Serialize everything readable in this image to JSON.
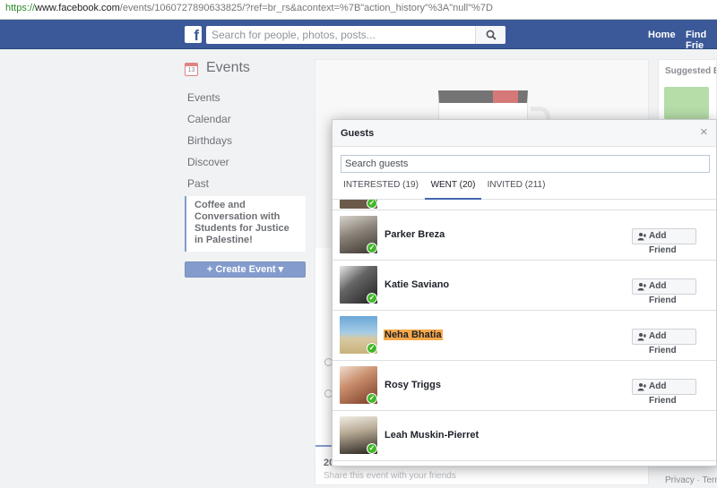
{
  "browser": {
    "url_scheme": "https://",
    "url_host": "www.facebook.com",
    "url_path": "/events/1060727890633825/?ref=br_rs&acontext=%7B\"action_history\"%3A\"null\"%7D"
  },
  "topbar": {
    "logo": "f",
    "search_placeholder": "Search for people, photos, posts...",
    "nav": [
      "Home",
      "Find Frie"
    ]
  },
  "left": {
    "calendar_icon_day": "13",
    "title": "Events",
    "items": [
      "Events",
      "Calendar",
      "Birthdays",
      "Discover",
      "Past"
    ],
    "selected_event": "Coffee and Conversation with Students for Justice in Palestine!",
    "create_button": "+ Create Event ▾"
  },
  "event_panel": {
    "count_text": "20",
    "share_text": "Share this event with your friends"
  },
  "right": {
    "title": "Suggested Ev",
    "footer": "Privacy · Term"
  },
  "dialog": {
    "title": "Guests",
    "close": "×",
    "search_placeholder": "Search guests",
    "tabs": [
      {
        "label": "INTERESTED (19)",
        "active": false
      },
      {
        "label": "WENT (20)",
        "active": true
      },
      {
        "label": "INVITED (211)",
        "active": false
      }
    ],
    "add_friend_label": "Add Friend",
    "guests": [
      {
        "name": "Parker Breza",
        "highlighted": false,
        "add_friend": true
      },
      {
        "name": "Katie Saviano",
        "highlighted": false,
        "add_friend": true
      },
      {
        "name": "Neha Bhatia",
        "highlighted": true,
        "add_friend": true
      },
      {
        "name": "Rosy Triggs",
        "highlighted": false,
        "add_friend": true
      },
      {
        "name": "Leah Muskin-Pierret",
        "highlighted": false,
        "add_friend": false
      }
    ],
    "colors": {
      "accent": "#4267b2",
      "went_check": "#42b72a",
      "highlight": "#f7a94a"
    }
  }
}
